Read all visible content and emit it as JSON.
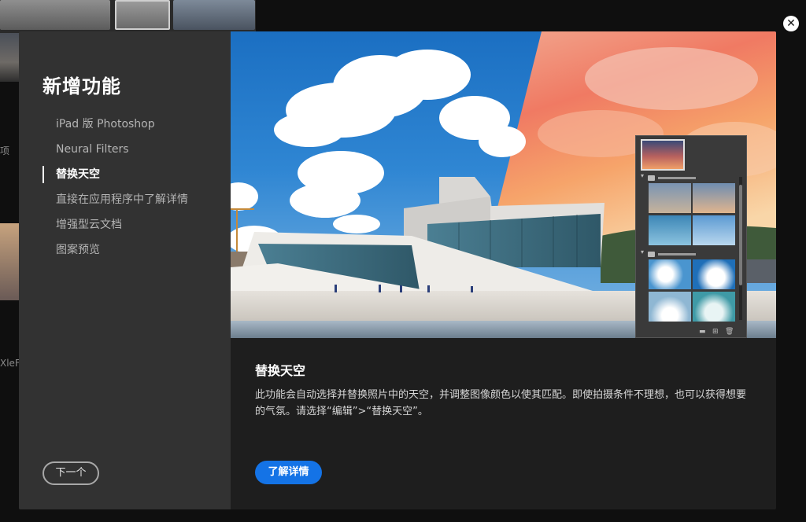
{
  "background": {
    "left_text_a": "项",
    "left_text_b": "XleF"
  },
  "modal": {
    "title": "新增功能",
    "nav_items": [
      {
        "label": "iPad 版 Photoshop",
        "active": false
      },
      {
        "label": "Neural Filters",
        "active": false
      },
      {
        "label": "替换天空",
        "active": true
      },
      {
        "label": "直接在应用程序中了解详情",
        "active": false
      },
      {
        "label": "增强型云文档",
        "active": false
      },
      {
        "label": "图案预览",
        "active": false
      }
    ],
    "next_button": "下一个",
    "close_icon": "close-icon"
  },
  "feature": {
    "title": "替换天空",
    "description": "此功能会自动选择并替换照片中的天空，并调整图像颜色以使其匹配。即使拍摄条件不理想，也可以获得想要的气氛。请选择“编辑”>“替换天空”。",
    "learn_more_button": "了解详情"
  },
  "sky_panel": {
    "footer_icons": [
      "folder-icon",
      "add-icon",
      "trash-icon"
    ]
  },
  "colors": {
    "accent": "#1473e6",
    "sidebar_bg": "#323232",
    "modal_bg": "#1e1e1e"
  }
}
